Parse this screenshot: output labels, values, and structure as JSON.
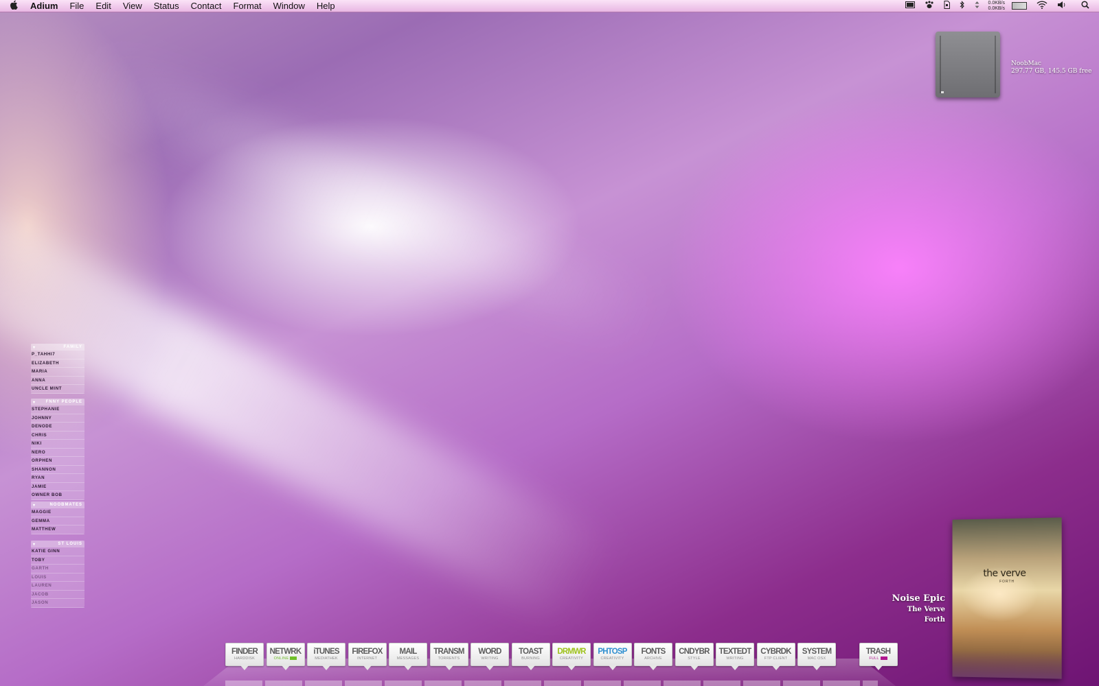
{
  "menubar": {
    "app_name": "Adium",
    "items": [
      "File",
      "Edit",
      "View",
      "Status",
      "Contact",
      "Format",
      "Window",
      "Help"
    ],
    "net_up": "0.0KB/s",
    "net_down": "0.0KB/s"
  },
  "disk": {
    "name": "NoobMac",
    "info": "297.77 GB, 145.5 GB free"
  },
  "buddy_list": {
    "groups": [
      {
        "name": "FAMILY",
        "buddies": [
          "P_TAHHI7",
          "ELIZABETH",
          "MARIA",
          "ANNA",
          "UNCLE MINT"
        ]
      },
      {
        "name": "FNNY PEOPLE",
        "buddies": [
          "STEPHANIE",
          "JOHNNY",
          "DENODE",
          "CHRIS",
          "NIKI",
          "NERO",
          "ORPHEN",
          "SHANNON",
          "RYAN",
          "JAMIE",
          "OWNER BOB"
        ]
      },
      {
        "name": "NOOBMATES",
        "buddies": [
          "MAGGIE",
          "GEMMA",
          "MATTHEW"
        ]
      },
      {
        "name": "ST LOUIS",
        "buddies": [
          "KATIE GINN",
          "TOBY",
          "GARTH",
          "LOUIS",
          "LAUREN",
          "JACOB",
          "JASON"
        ]
      }
    ]
  },
  "now_playing": {
    "track": "Noise Epic",
    "artist": "The Verve",
    "album": "Forth",
    "cover_title": "the verve",
    "cover_subtitle": "FORTH"
  },
  "dock": {
    "items": [
      {
        "title": "FINDER",
        "sub": "HARDDISK"
      },
      {
        "title": "NETWRK",
        "sub": "ONLINE"
      },
      {
        "title": "iTUNES",
        "sub": "MEDIATHEK"
      },
      {
        "title": "FIREFOX",
        "sub": "INTERNET"
      },
      {
        "title": "MAIL",
        "sub": "MESSAGES"
      },
      {
        "title": "TRANSM",
        "sub": "TORRENTS"
      },
      {
        "title": "WORD",
        "sub": "WRITING"
      },
      {
        "title": "TOAST",
        "sub": "BURNING"
      },
      {
        "title": "DRMWR",
        "sub": "CREATIVITY"
      },
      {
        "title": "PHTOSP",
        "sub": "CREATIVITY"
      },
      {
        "title": "FONTS",
        "sub": "ARCHIVE"
      },
      {
        "title": "CNDYBR",
        "sub": "STYLE"
      },
      {
        "title": "TEXTEDT",
        "sub": "WRITING"
      },
      {
        "title": "CYBRDK",
        "sub": "FTP CLIENT"
      },
      {
        "title": "SYSTEM",
        "sub": "MAC OSX"
      }
    ],
    "trash": {
      "title": "TRASH",
      "sub": "FULL"
    }
  },
  "colors": {
    "dreamweaver": "#9ec21b",
    "photoshop": "#2f8fd0",
    "online": "#6fbf2a",
    "trash_full": "#b0178f"
  }
}
